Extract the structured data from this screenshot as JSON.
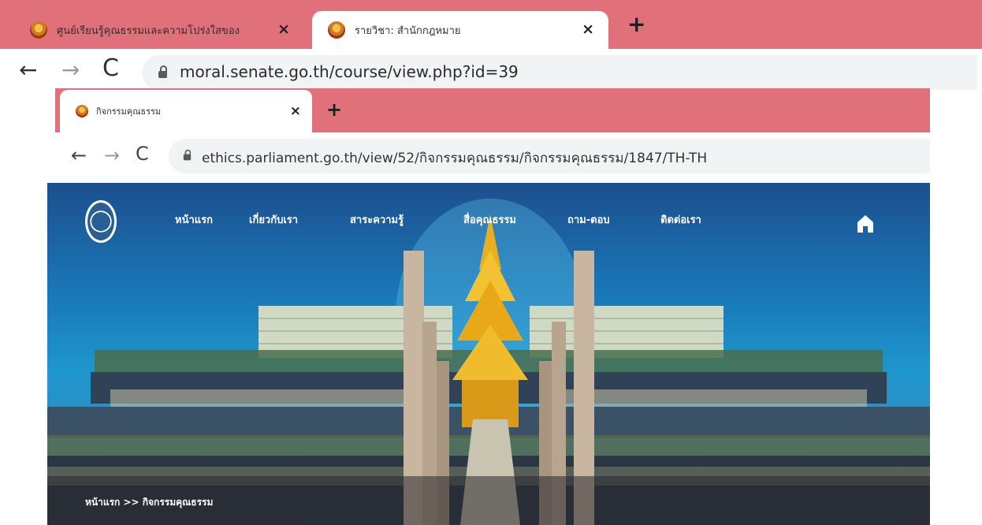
{
  "outer_browser": {
    "tabs": [
      {
        "title": "ศูนย์เรียนรู้คุณธรรมและความโปร่งใสของ",
        "close": "×"
      },
      {
        "title": "รายวิชา: สำนักกฎหมาย",
        "close": "×"
      }
    ],
    "new_tab": "+",
    "nav": {
      "back": "←",
      "forward": "→",
      "reload": "C"
    },
    "url": "moral.senate.go.th/course/view.php?id=39"
  },
  "inner_browser": {
    "tab": {
      "title": "กิจกรรมคุณธรรม",
      "close": "×"
    },
    "new_tab": "+",
    "nav": {
      "back": "←",
      "forward": "→",
      "reload": "C"
    },
    "url": "ethics.parliament.go.th/view/52/กิจกรรมคุณธรรม/กิจกรรมคุณธรรม/1847/TH-TH"
  },
  "site": {
    "menu": [
      "หน้าแรก",
      "เกี่ยวกับเรา",
      "สาระความรู้",
      "สื่อคุณธรรม",
      "ถาม-ตอบ",
      "ติดต่อเรา"
    ],
    "breadcrumb": "หน้าแรก >> กิจกรรมคุณธรรม"
  },
  "colors": {
    "tabbar": "#e0707a",
    "omnibox": "#f1f3f4",
    "sky": "#1e96ce",
    "spire": "#e8b020"
  },
  "icons": {
    "favicon": "parliament-seal-icon",
    "lock": "lock-icon",
    "home": "home-icon"
  }
}
